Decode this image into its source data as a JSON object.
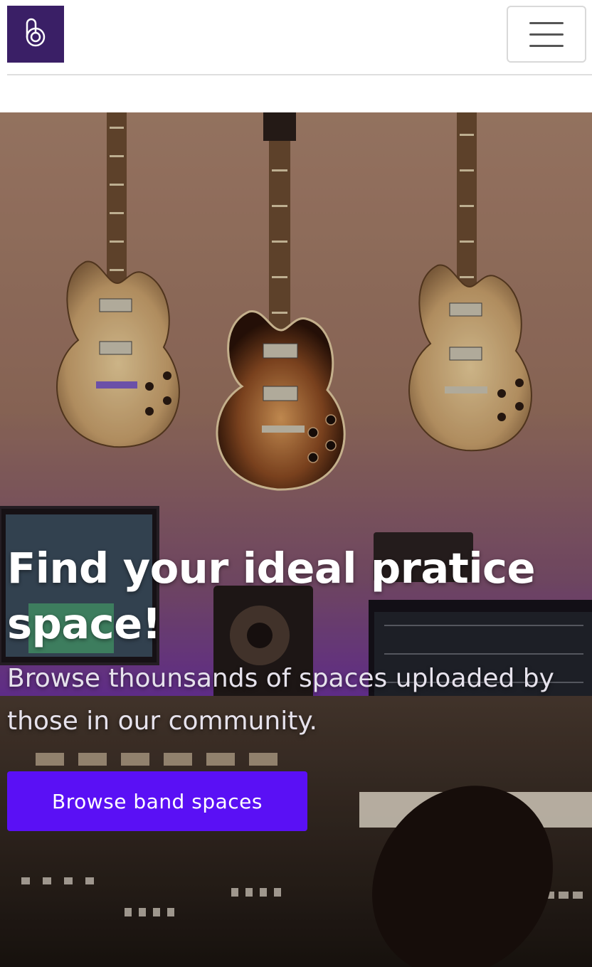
{
  "brand": {
    "logo_icon": "b-logo-icon",
    "color": "#3a1f66"
  },
  "navbar": {
    "menu_icon": "hamburger-menu-icon"
  },
  "hero": {
    "title": "Find your ideal pratice space!",
    "subtitle": "Browse thounsands of spaces uploaded by those in our community.",
    "cta_label": "Browse band spaces",
    "cta_color": "#5a10f5",
    "background": "recording-studio-guitars-photo"
  }
}
